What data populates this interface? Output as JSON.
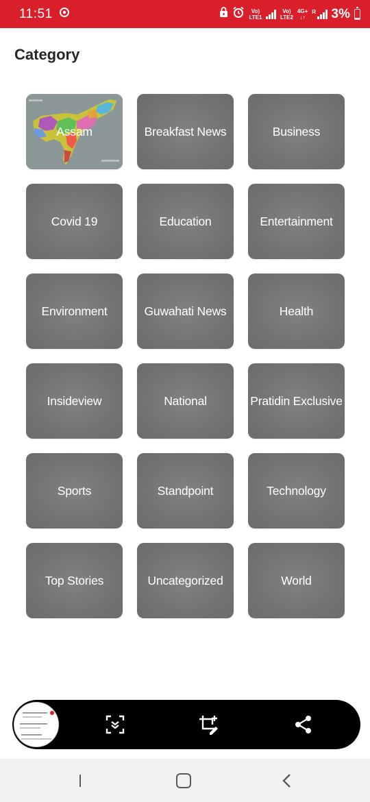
{
  "status_bar": {
    "time": "11:51",
    "sim1_label_top": "Vo)",
    "sim1_label_bottom": "LTE1",
    "sim2_label_top": "Vo)",
    "sim2_label_bottom": "LTE2",
    "net_label_top": "4G+",
    "net_label_bottom": "↓↑",
    "roaming_label": "R",
    "battery_percent": "3%",
    "background_color": "#d81f2a"
  },
  "page": {
    "title": "Category"
  },
  "categories": [
    {
      "label": "Assam",
      "image": "assam-map"
    },
    {
      "label": "Breakfast News"
    },
    {
      "label": "Business"
    },
    {
      "label": "Covid 19"
    },
    {
      "label": "Education"
    },
    {
      "label": "Entertainment"
    },
    {
      "label": "Environment"
    },
    {
      "label": "Guwahati News"
    },
    {
      "label": "Health"
    },
    {
      "label": "Insideview"
    },
    {
      "label": "National"
    },
    {
      "label": "Pratidin Exclusive"
    },
    {
      "label": "Sports"
    },
    {
      "label": "Standpoint"
    },
    {
      "label": "Technology"
    },
    {
      "label": "Top Stories"
    },
    {
      "label": "Uncategorized"
    },
    {
      "label": "World"
    }
  ],
  "screenshot_toolbar": {
    "icons": [
      "screenshot-thumbnail",
      "scroll-capture-icon",
      "crop-edit-icon",
      "share-icon"
    ]
  },
  "nav_bar": {
    "icons": [
      "recent-apps-icon",
      "home-icon",
      "back-icon"
    ]
  },
  "colors": {
    "accent": "#d81f2a",
    "tile": "#777777",
    "tile_text": "#ffffff"
  }
}
